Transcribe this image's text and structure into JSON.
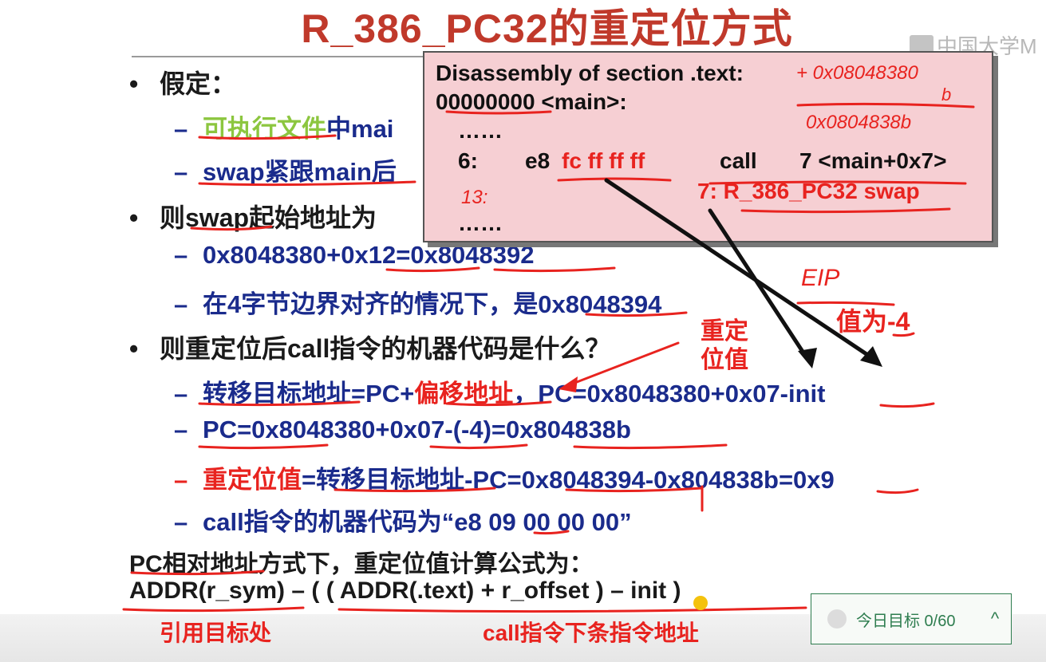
{
  "slide": {
    "title": "R_386_PC32的重定位方式",
    "watermark": "中国大学M",
    "lines": {
      "assume": "假定：",
      "assume_a_1": "可执行文件",
      "assume_a_2": "中mai",
      "assume_b": "swap紧跟main后",
      "swap_start": "则swap起始地址为",
      "calc1": "0x8048380+0x12=0x8048392",
      "calc2": "在4字节边界对齐的情况下，是0x8048394",
      "question": "则重定位后call指令的机器代码是什么？",
      "target_1": "转移目标地址=PC+",
      "target_2": "偏移地址",
      "target_3": "，PC=0x8048380+0x07-init",
      "pc": "PC=0x8048380+0x07-(-4)=0x804838b",
      "reloc_1": "重定位值",
      "reloc_2": "=转移目标地址-PC=0x8048394-0x804838b=0x9",
      "code": "call指令的机器代码为“e8 09 00 00 00”",
      "formula_title": "PC相对地址方式下，重定位值计算公式为：",
      "formula": "ADDR(r_sym) – ( ( ADDR(.text) + r_offset ) – init )"
    },
    "popup": {
      "heading": "Disassembly of section .text:",
      "main_label": "00000000 <main>:",
      "dots": "……",
      "offset": "6:",
      "opcode": "e8",
      "bytes": "fc ff ff ff",
      "instr": "call",
      "operand": "7 <main+0x7>",
      "reloc_entry": "7: R_386_PC32  swap",
      "dots2": "……"
    },
    "annotations": {
      "hex_add1": "+ 0x08048380",
      "hex_add2": "b",
      "hex_sum": "0x0804838b",
      "hand13": "13:",
      "eip": "EIP",
      "value": "值为-4",
      "reloc_value_1": "重定",
      "reloc_value_2": "位值"
    },
    "bottom_labels": {
      "left": "引用目标处",
      "right": "call指令下条指令地址"
    }
  },
  "goal_widget": {
    "text": "今日目标 0/60",
    "chevron": "^"
  }
}
